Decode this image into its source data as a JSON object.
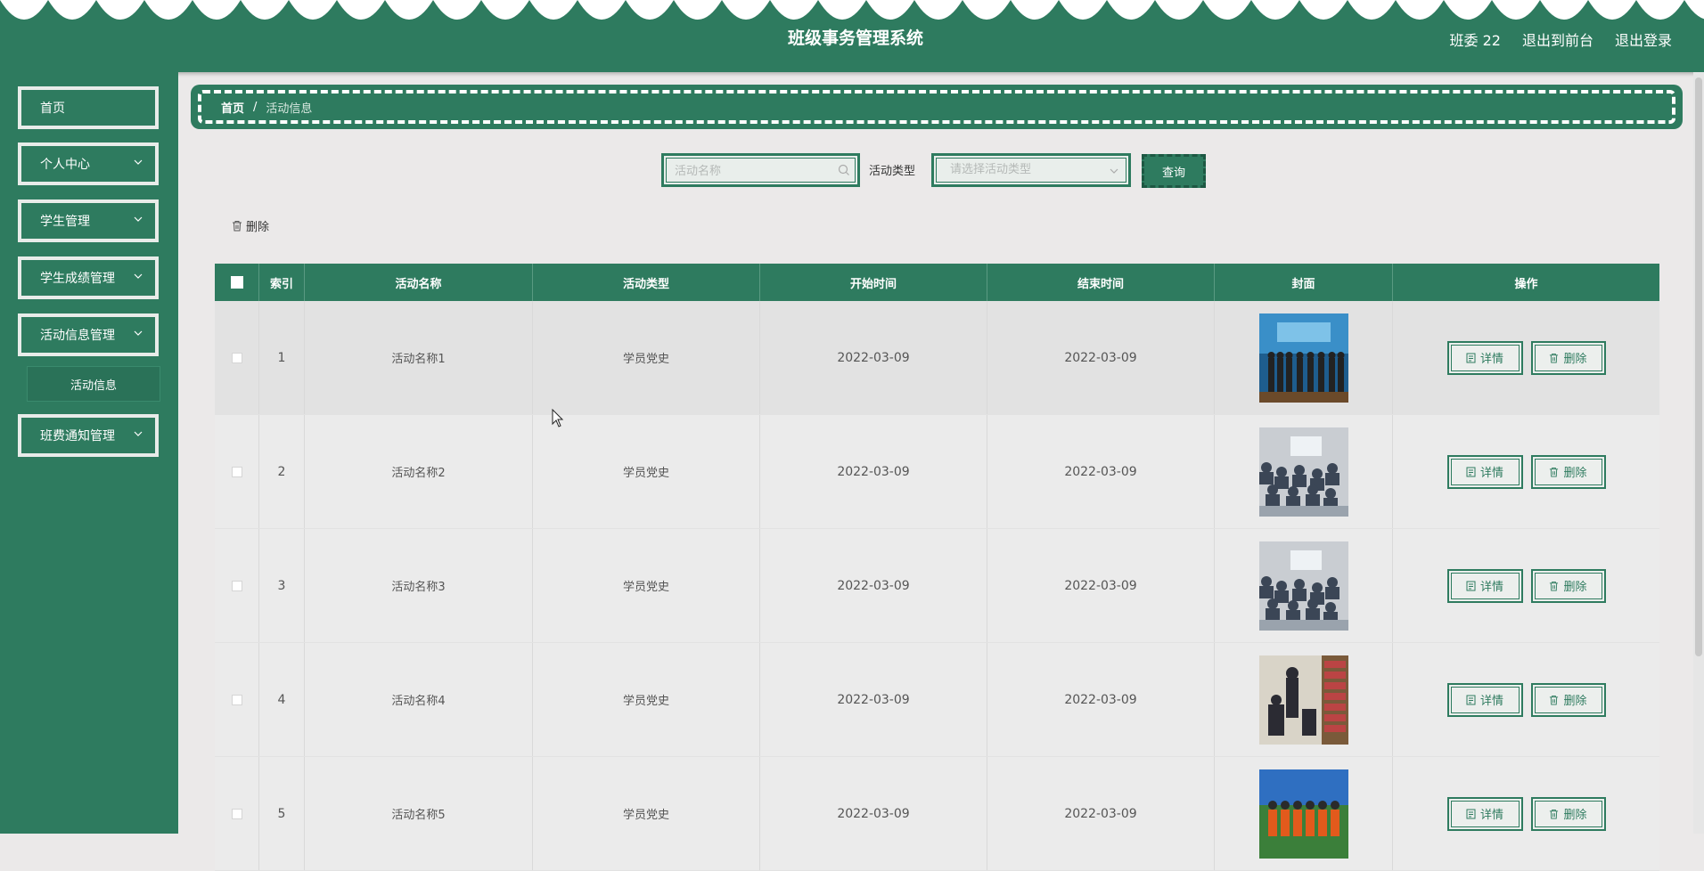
{
  "header": {
    "title": "班级事务管理系统",
    "user": "班委 22",
    "exit_front": "退出到前台",
    "logout": "退出登录"
  },
  "sidebar": {
    "items": [
      {
        "label": "首页",
        "has_children": false
      },
      {
        "label": "个人中心",
        "has_children": true
      },
      {
        "label": "学生管理",
        "has_children": true
      },
      {
        "label": "学生成绩管理",
        "has_children": true
      },
      {
        "label": "活动信息管理",
        "has_children": true
      },
      {
        "label": "班费通知管理",
        "has_children": true
      }
    ],
    "subitem": "活动信息"
  },
  "breadcrumb": {
    "home": "首页",
    "separator": "/",
    "current": "活动信息"
  },
  "search": {
    "name_placeholder": "活动名称",
    "type_label": "活动类型",
    "type_placeholder": "请选择活动类型",
    "query_button": "查询",
    "delete_button": "删除"
  },
  "table": {
    "headers": [
      "索引",
      "活动名称",
      "活动类型",
      "开始时间",
      "结束时间",
      "封面",
      "操作"
    ],
    "detail_label": "详情",
    "delete_label": "删除",
    "rows": [
      {
        "index": "1",
        "name": "活动名称1",
        "type": "学员党史",
        "start": "2022-03-09",
        "end": "2022-03-09",
        "cover": "cover-stage-group"
      },
      {
        "index": "2",
        "name": "活动名称2",
        "type": "学员党史",
        "start": "2022-03-09",
        "end": "2022-03-09",
        "cover": "cover-classroom"
      },
      {
        "index": "3",
        "name": "活动名称3",
        "type": "学员党史",
        "start": "2022-03-09",
        "end": "2022-03-09",
        "cover": "cover-classroom"
      },
      {
        "index": "4",
        "name": "活动名称4",
        "type": "学员党史",
        "start": "2022-03-09",
        "end": "2022-03-09",
        "cover": "cover-library"
      },
      {
        "index": "5",
        "name": "活动名称5",
        "type": "学员党史",
        "start": "2022-03-09",
        "end": "2022-03-09",
        "cover": "cover-outdoor"
      }
    ]
  },
  "colors": {
    "primary": "#2e7b5f",
    "background": "#ebe9e9"
  }
}
